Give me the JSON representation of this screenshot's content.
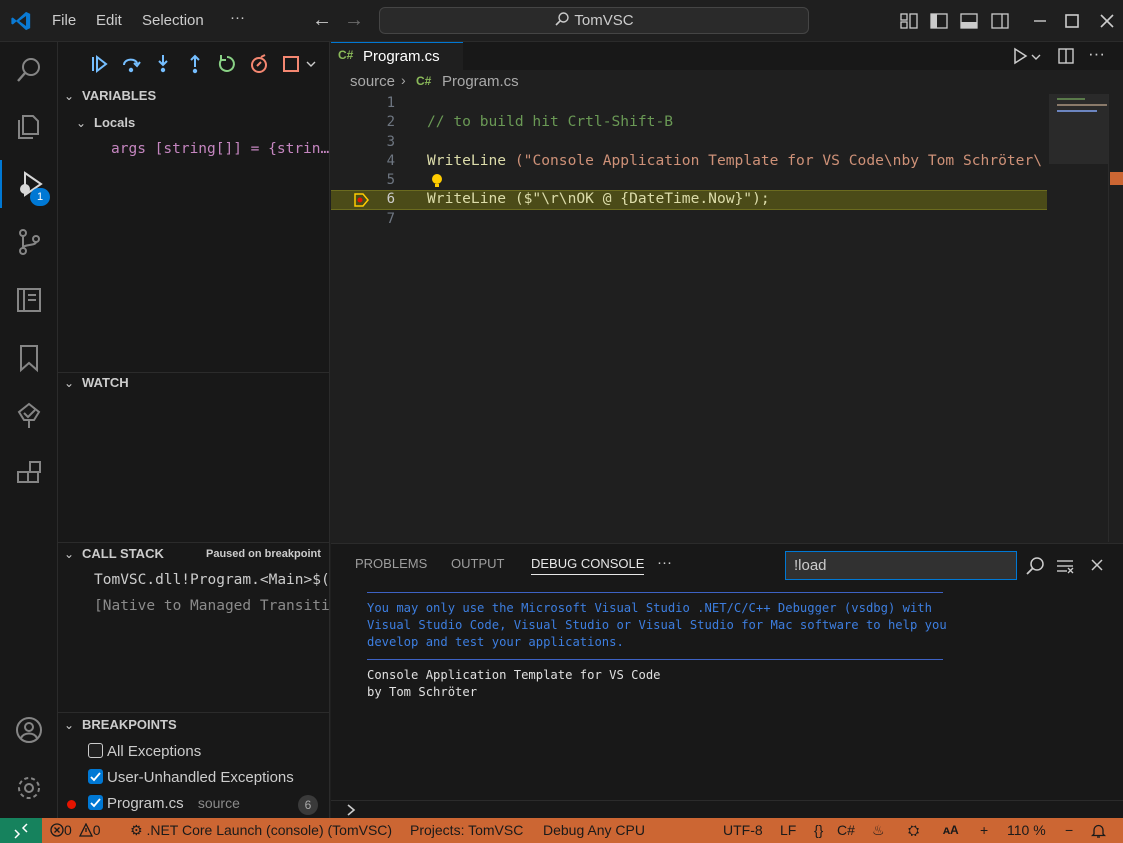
{
  "titlebar": {
    "menu": [
      "File",
      "Edit",
      "Selection"
    ],
    "more": "···",
    "search": "TomVSC"
  },
  "activity": {
    "debug_badge": "1"
  },
  "sidebar": {
    "variables_title": "VARIABLES",
    "locals_label": "Locals",
    "locals_item": "args [string[]] = {strin…",
    "watch_title": "WATCH",
    "callstack_title": "CALL STACK",
    "callstack_status": "Paused on breakpoint",
    "callstack_frames": [
      "TomVSC.dll!Program.<Main>$(",
      "[Native to Managed Transiti"
    ],
    "breakpoints_title": "BREAKPOINTS",
    "breakpoints": [
      {
        "label": "All Exceptions",
        "checked": false
      },
      {
        "label": "User-Unhandled Exceptions",
        "checked": true
      },
      {
        "label": "Program.cs",
        "detail": "source",
        "line": "6",
        "checked": true
      }
    ]
  },
  "editor": {
    "tab_label": "Program.cs",
    "tab_lang": "C#",
    "breadcrumb_folder": "source",
    "breadcrumb_lang": "C#",
    "breadcrumb_file": "Program.cs",
    "lines": [
      {
        "n": "1",
        "text": ""
      },
      {
        "n": "2",
        "text": "// to build hit Crtl-Shift-B"
      },
      {
        "n": "3",
        "text": ""
      },
      {
        "n": "4",
        "pre": "WriteLine ",
        "text": "(\"Console Application Template for VS Code\\nby Tom Schröter\\"
      },
      {
        "n": "5",
        "text": ""
      },
      {
        "n": "6",
        "text": "WriteLine ($\"\\r\\nOK @ {DateTime.Now}\");"
      },
      {
        "n": "7",
        "text": ""
      }
    ]
  },
  "panel": {
    "tabs": [
      "PROBLEMS",
      "OUTPUT",
      "DEBUG CONSOLE"
    ],
    "active_tab": "DEBUG CONSOLE",
    "more": "···",
    "filter_value": "!load",
    "notice": [
      "You may only use the Microsoft Visual Studio .NET/C/C++ Debugger (vsdbg) with",
      "Visual Studio Code, Visual Studio or Visual Studio for Mac software to help you",
      "develop and test your applications."
    ],
    "output": [
      "Console Application Template for VS Code",
      "by Tom Schröter"
    ]
  },
  "statusbar": {
    "errors": "0",
    "warnings": "0",
    "launch": ".NET Core Launch (console) (TomVSC)",
    "projects": "Projects: TomVSC",
    "config": "Debug Any CPU",
    "encoding": "UTF-8",
    "eol": "LF",
    "braces": "{}",
    "language": "C#",
    "zoom": "110 %",
    "plus": "+",
    "minus": "−"
  },
  "colors": {
    "accent": "#0078d4",
    "statusbar": "#cc6633",
    "remote": "#16825d",
    "highlight": "#4b4b18"
  }
}
